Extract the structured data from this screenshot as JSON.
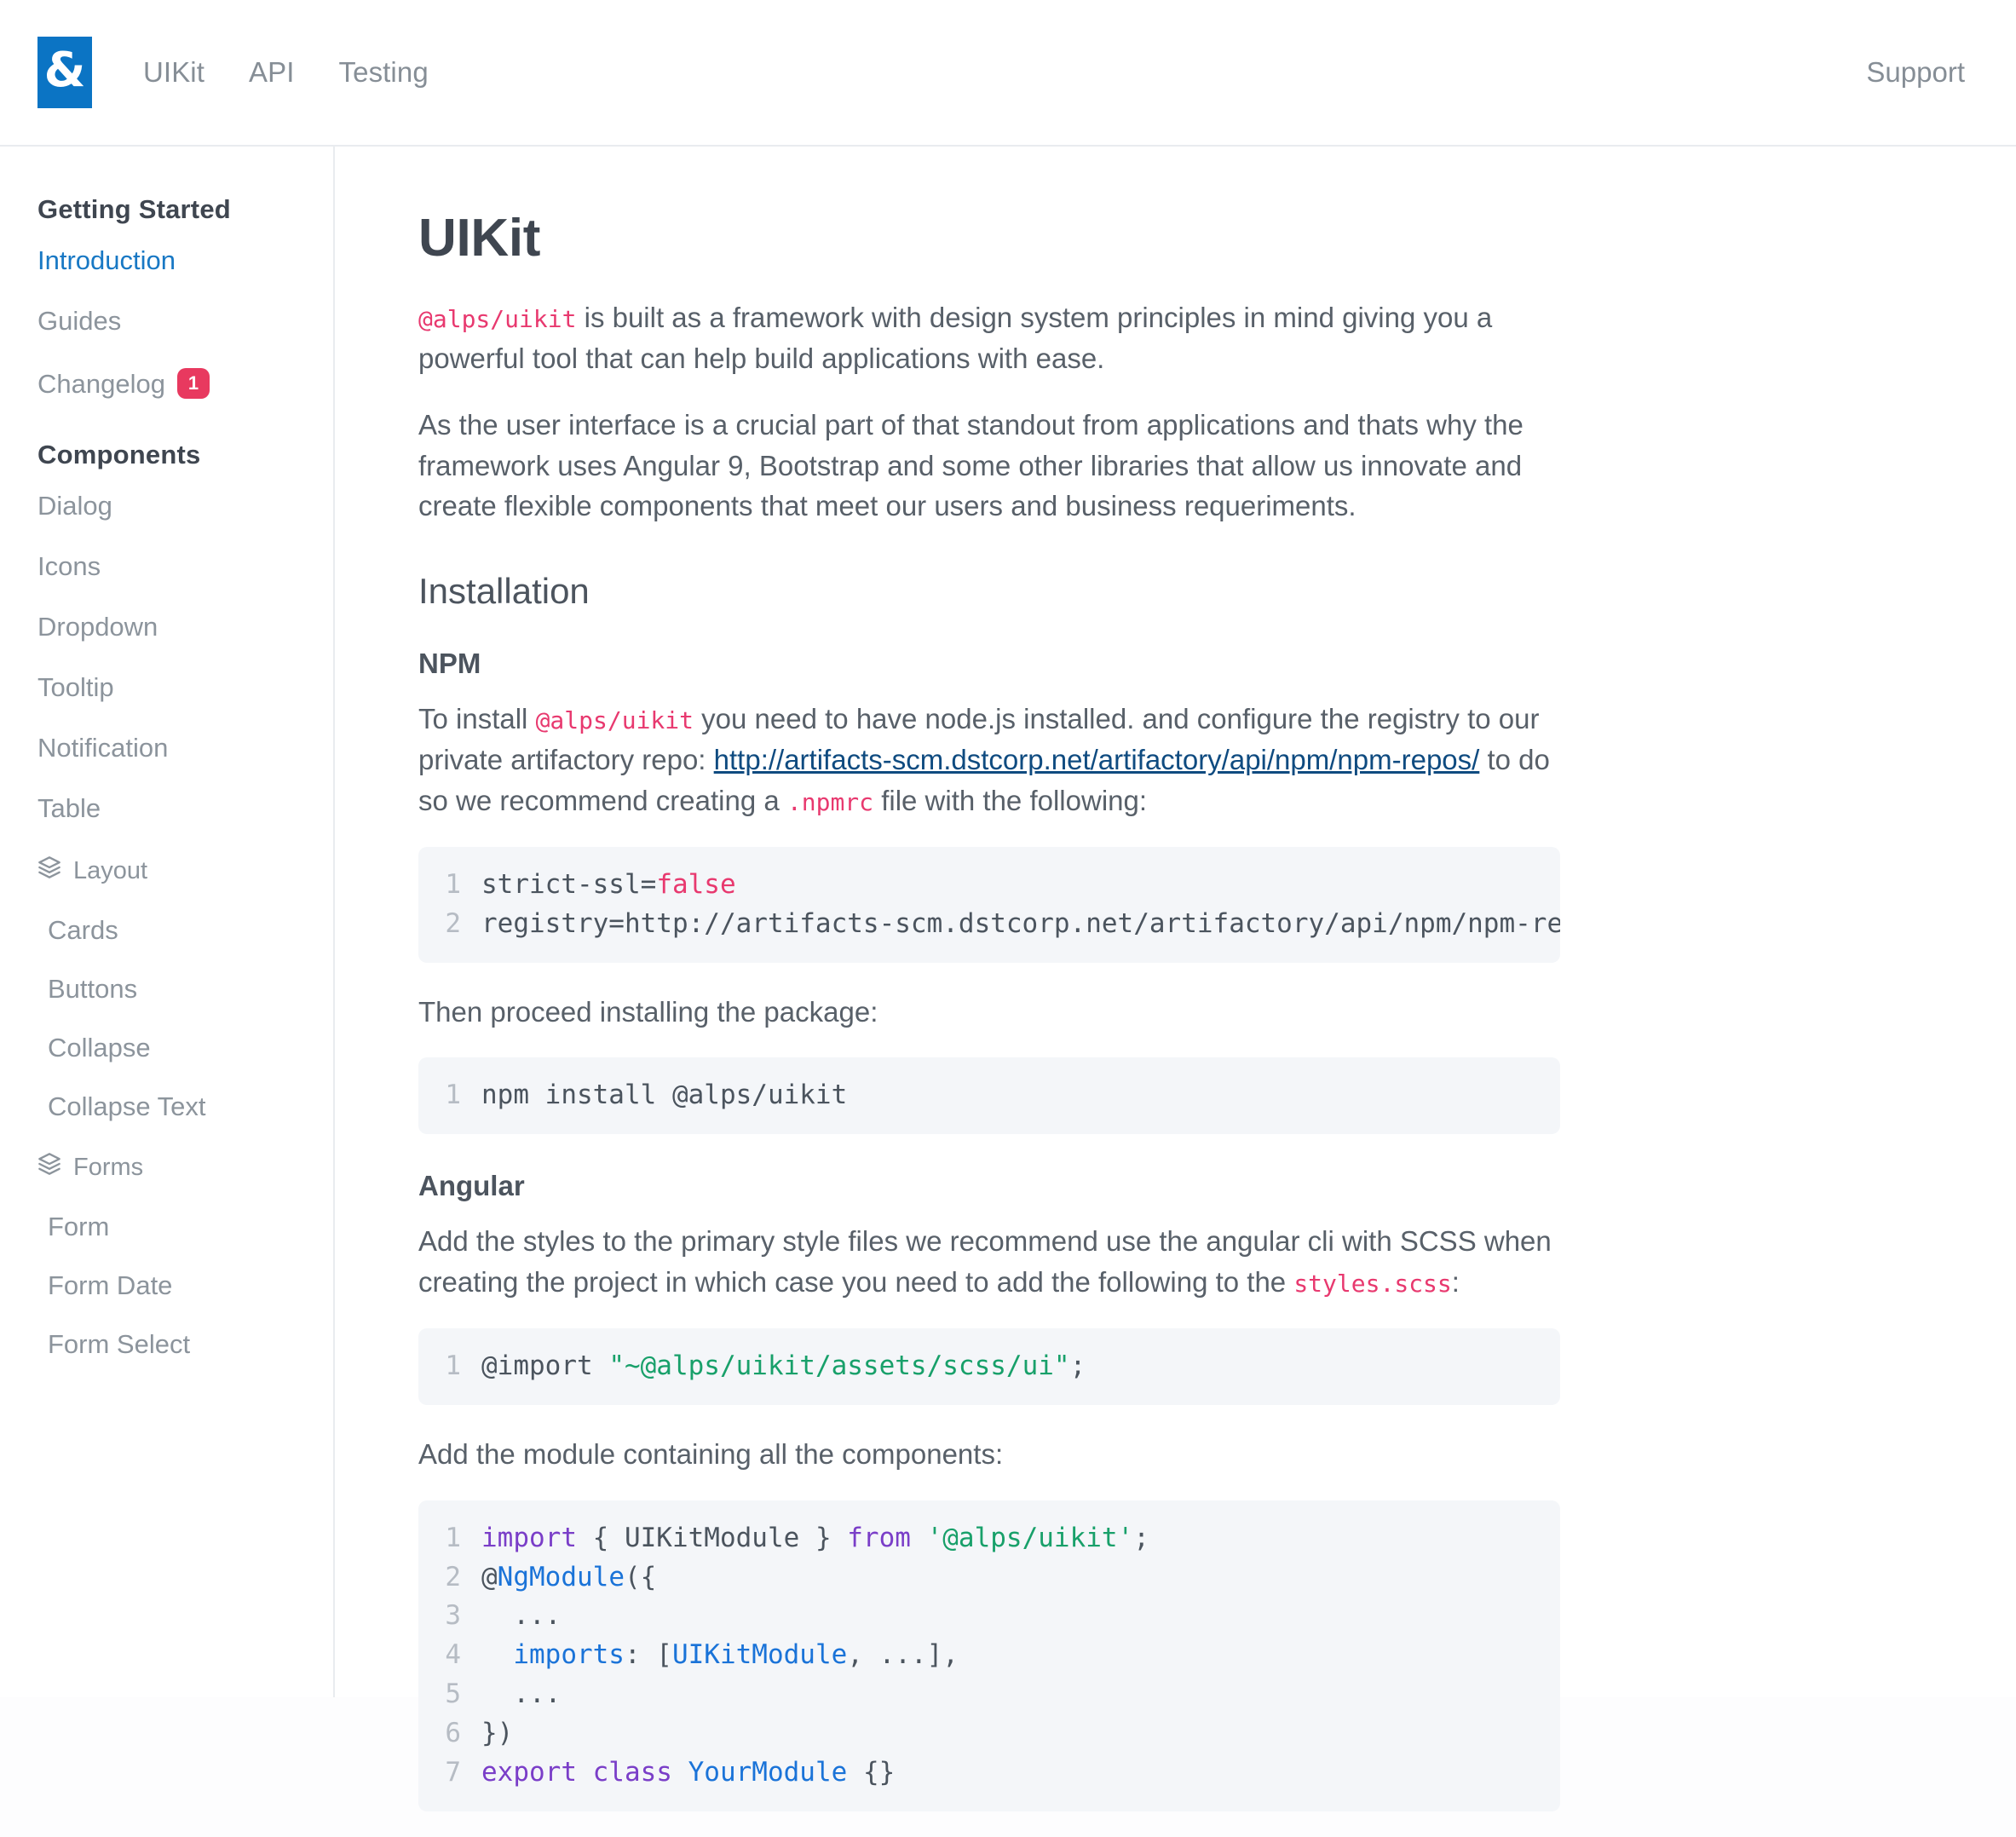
{
  "header": {
    "logo_text": "&",
    "nav": [
      {
        "label": "UIKit"
      },
      {
        "label": "API"
      },
      {
        "label": "Testing"
      }
    ],
    "support_label": "Support"
  },
  "sidebar": {
    "groups": [
      {
        "title": "Getting Started",
        "items": [
          {
            "label": "Introduction",
            "active": true
          },
          {
            "label": "Guides",
            "active": false
          },
          {
            "label": "Changelog",
            "active": false,
            "badge": "1"
          }
        ]
      },
      {
        "title": "Components",
        "items": [
          {
            "label": "Dialog"
          },
          {
            "label": "Icons"
          },
          {
            "label": "Dropdown"
          },
          {
            "label": "Tooltip"
          },
          {
            "label": "Notification"
          },
          {
            "label": "Table"
          }
        ],
        "subgroups": [
          {
            "icon": "layers-icon",
            "title": "Layout",
            "items": [
              {
                "label": "Cards"
              },
              {
                "label": "Buttons"
              },
              {
                "label": "Collapse"
              },
              {
                "label": "Collapse Text"
              }
            ]
          },
          {
            "icon": "layers-icon",
            "title": "Forms",
            "items": [
              {
                "label": "Form"
              },
              {
                "label": "Form Date"
              },
              {
                "label": "Form Select"
              }
            ]
          }
        ]
      }
    ]
  },
  "main": {
    "title": "UIKit",
    "intro_code": "@alps/uikit",
    "intro_rest": " is built as a framework with design system principles in mind giving you a powerful tool that can help build applications with ease.",
    "paragraph_2": "As the user interface is a crucial part of that standout from applications and thats why the framework uses Angular 9, Bootstrap and some other libraries that allow us innovate and create flexible components that meet our users and business requeriments.",
    "installation_heading": "Installation",
    "npm": {
      "heading": "NPM",
      "text_1": "To install ",
      "code_1": "@alps/uikit",
      "text_2": " you need to have node.js installed. and configure the registry to our private artifactory repo: ",
      "link": "http://artifacts-scm.dstcorp.net/artifactory/api/npm/npm-repos/",
      "text_3": " to do so we recommend creating a ",
      "code_2": ".npmrc",
      "text_4": " file with the following:",
      "code_block_1": {
        "lines": [
          {
            "n": "1",
            "parts": [
              {
                "t": "strict-ssl=",
                "c": "ct"
              },
              {
                "t": "false",
                "c": "tok-lit"
              }
            ]
          },
          {
            "n": "2",
            "parts": [
              {
                "t": "registry=http://artifacts-scm.dstcorp.net/artifactory/api/npm/npm-repos/",
                "c": "ct"
              }
            ]
          }
        ]
      },
      "text_5": "Then proceed installing the package:",
      "code_block_2": {
        "lines": [
          {
            "n": "1",
            "parts": [
              {
                "t": "npm install @alps/uikit",
                "c": "ct"
              }
            ]
          }
        ]
      }
    },
    "angular": {
      "heading": "Angular",
      "text_1": "Add the styles to the primary style files we recommend use the angular cli with SCSS when creating the project in which case you need to add the following to the ",
      "code_1": "styles.scss",
      "text_2": ":",
      "code_block_1": {
        "lines": [
          {
            "n": "1",
            "parts": [
              {
                "t": "@import ",
                "c": "ct"
              },
              {
                "t": "\"~@alps/uikit/assets/scss/ui\"",
                "c": "tok-str"
              },
              {
                "t": ";",
                "c": "ct"
              }
            ]
          }
        ]
      },
      "text_3": "Add the module containing all the components:",
      "code_block_2": {
        "lines": [
          {
            "n": "1",
            "parts": [
              {
                "t": "import",
                "c": "tok-kw"
              },
              {
                "t": " { UIKitModule } ",
                "c": "ct"
              },
              {
                "t": "from",
                "c": "tok-kw"
              },
              {
                "t": " ",
                "c": "ct"
              },
              {
                "t": "'@alps/uikit'",
                "c": "tok-str"
              },
              {
                "t": ";",
                "c": "ct"
              }
            ]
          },
          {
            "n": "2",
            "parts": [
              {
                "t": "@",
                "c": "ct"
              },
              {
                "t": "NgModule",
                "c": "tok-fn"
              },
              {
                "t": "({",
                "c": "ct"
              }
            ]
          },
          {
            "n": "3",
            "parts": [
              {
                "t": "  ...",
                "c": "ct"
              }
            ]
          },
          {
            "n": "4",
            "parts": [
              {
                "t": "  ",
                "c": "ct"
              },
              {
                "t": "imports",
                "c": "tok-fn"
              },
              {
                "t": ": [",
                "c": "ct"
              },
              {
                "t": "UIKitModule",
                "c": "tok-cls"
              },
              {
                "t": ", ...],",
                "c": "ct"
              }
            ]
          },
          {
            "n": "5",
            "parts": [
              {
                "t": "  ...",
                "c": "ct"
              }
            ]
          },
          {
            "n": "6",
            "parts": [
              {
                "t": "})",
                "c": "ct"
              }
            ]
          },
          {
            "n": "7",
            "parts": [
              {
                "t": "export class",
                "c": "tok-kw"
              },
              {
                "t": " ",
                "c": "ct"
              },
              {
                "t": "YourModule",
                "c": "tok-cls"
              },
              {
                "t": " {}",
                "c": "ct"
              }
            ]
          }
        ]
      }
    }
  },
  "colors": {
    "brand_blue": "#0b74c4",
    "active_link": "#1878c4",
    "badge_red": "#e8395f",
    "inline_code_pink": "#e8396f",
    "string_green": "#18a06a",
    "keyword_purple": "#7a3ec8",
    "code_bg": "#f4f6f9"
  }
}
